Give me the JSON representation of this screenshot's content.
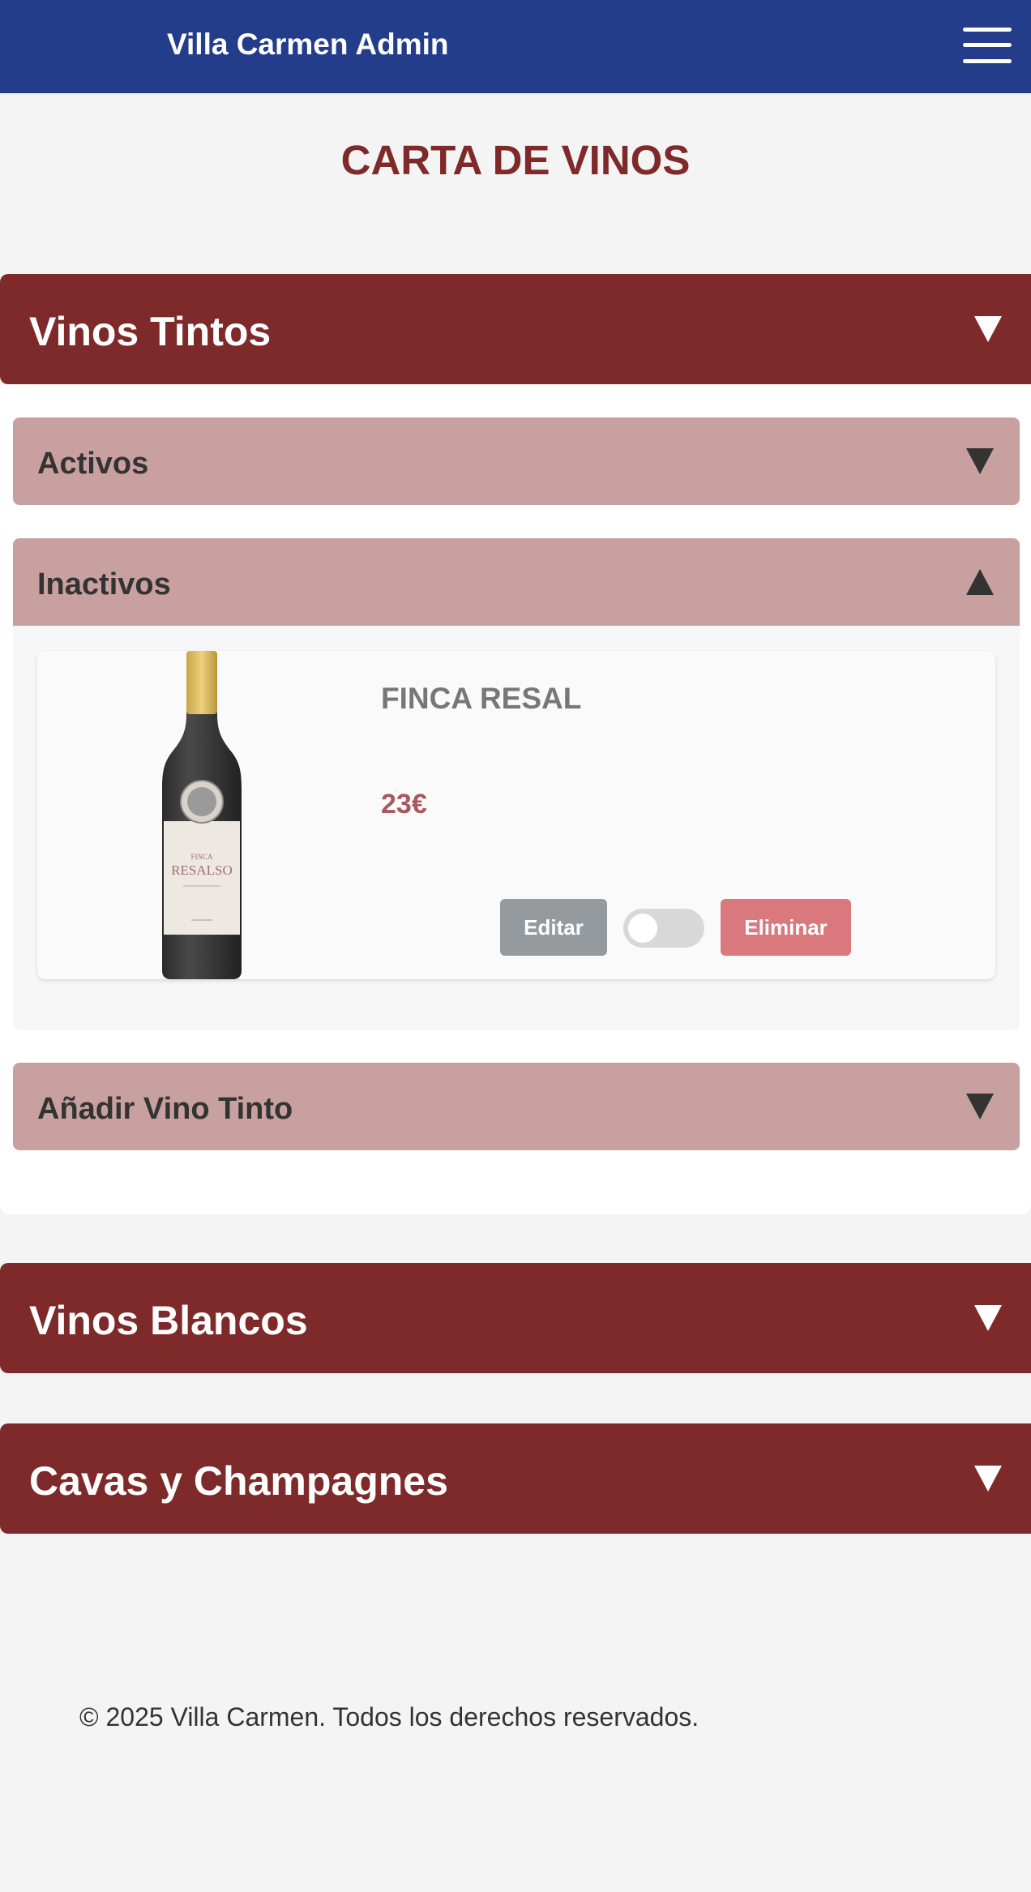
{
  "header": {
    "brand": "Villa Carmen Admin",
    "menu_icon": "hamburger-menu-icon",
    "background_color": "#233d8b"
  },
  "page": {
    "title": "CARTA DE VINOS"
  },
  "sections": [
    {
      "label": "Vinos Tintos",
      "expanded": true,
      "subsections": [
        {
          "label": "Activos",
          "expanded": false
        },
        {
          "label": "Inactivos",
          "expanded": true,
          "wines": [
            {
              "name": "FINCA RESAL",
              "price": "23€",
              "active": false,
              "edit_label": "Editar",
              "delete_label": "Eliminar",
              "bottle_label_lines": [
                "FINCA",
                "RESALSO"
              ]
            }
          ]
        },
        {
          "label": "Añadir Vino Tinto",
          "expanded": false
        }
      ]
    },
    {
      "label": "Vinos Blancos",
      "expanded": false
    },
    {
      "label": "Cavas y Champagnes",
      "expanded": false
    }
  ],
  "footer": {
    "text": "© 2025 Villa Carmen. Todos los derechos reservados."
  },
  "colors": {
    "accent": "#7f2a2a",
    "subsection": "#c9a0a0",
    "edit_button": "#959a9e",
    "delete_button": "#d9787d",
    "price": "#a8595e"
  },
  "icons": {
    "collapsed": "triangle-down-icon",
    "expanded": "triangle-up-icon"
  }
}
